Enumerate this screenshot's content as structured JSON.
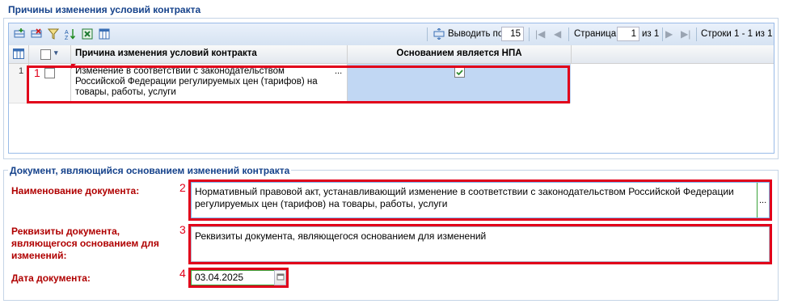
{
  "reasons_section": {
    "title": "Причины изменения условий контракта"
  },
  "toolbar": {
    "icons": [
      "add-row-icon",
      "delete-row-icon",
      "filter-icon",
      "sort-icon",
      "excel-export-icon",
      "columns-icon",
      "separator-settings-icon"
    ],
    "page_size_label": "Выводить по",
    "page_size_value": "15",
    "page_label": "Страница",
    "page_value": "1",
    "page_of": "из 1",
    "rows_info": "Строки 1 - 1 из 1"
  },
  "grid": {
    "columns": [
      "Причина изменения условий контракта",
      "Основанием является НПА"
    ],
    "rows": [
      {
        "num": "1",
        "reason": "Изменение в соответствии с законодательством Российской Федерации регулируемых цен (тарифов) на товары, работы, услуги",
        "ellipsis": "...",
        "npa_checked": true
      }
    ]
  },
  "document_section": {
    "title": "Документ, являющийся основанием изменений контракта",
    "name_label": "Наименование документа:",
    "name_value": "Нормативный правовой акт, устанавливающий изменение в соответствии с законодательством Российской Федерации регулируемых цен (тарифов) на товары, работы, услуги",
    "name_button": "...",
    "requisites_label": "Реквизиты документа, являющегося основанием для изменений:",
    "requisites_value": "Реквизиты документа, являющегося основанием для изменений",
    "date_label": "Дата документа:",
    "date_value": "03.04.2025"
  },
  "annotations": [
    "1",
    "2",
    "3",
    "4"
  ],
  "colors": {
    "accent": "#15428b",
    "highlight": "#e1001a",
    "selected_cell": "#c1d7f3"
  }
}
